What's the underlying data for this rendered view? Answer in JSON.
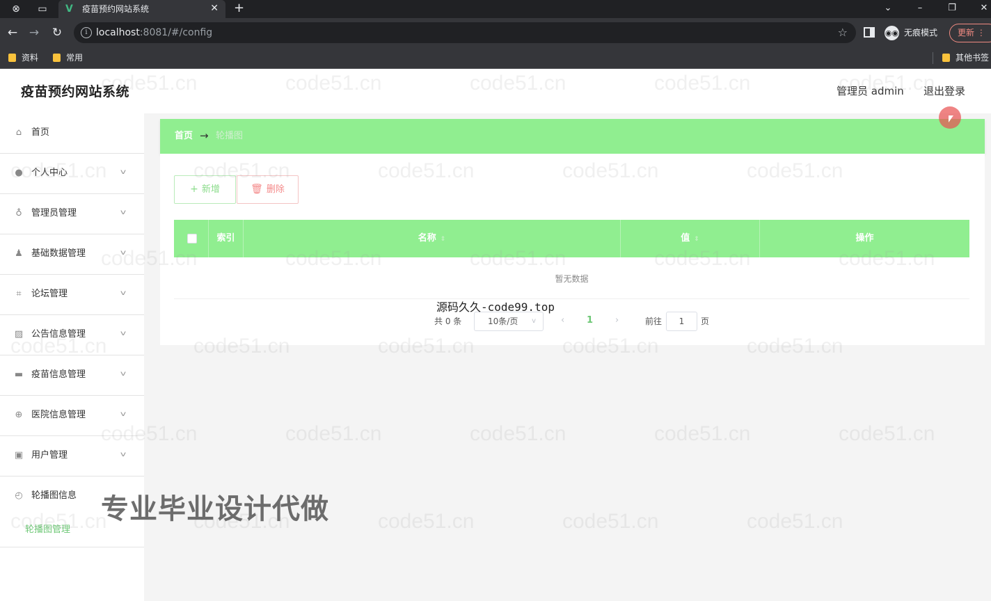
{
  "browser": {
    "tab_title": "疫苗预约网站系统",
    "tab_favicon": "V",
    "url_host": "localhost",
    "url_rest": ":8081/#/config",
    "incognito_label": "无痕模式",
    "update_label": "更新",
    "bookmarks": [
      "资料",
      "常用"
    ],
    "other_bookmarks": "其他书签"
  },
  "header": {
    "title": "疫苗预约网站系统",
    "user": "管理员 admin",
    "logout": "退出登录"
  },
  "sidebar": {
    "items": [
      {
        "label": "首页",
        "icon": "home-icon",
        "expandable": false
      },
      {
        "label": "个人中心",
        "icon": "user-icon",
        "expandable": true
      },
      {
        "label": "管理员管理",
        "icon": "microphone-icon",
        "expandable": true
      },
      {
        "label": "基础数据管理",
        "icon": "person-icon",
        "expandable": true
      },
      {
        "label": "论坛管理",
        "icon": "crop-icon",
        "expandable": true
      },
      {
        "label": "公告信息管理",
        "icon": "chart-icon",
        "expandable": true
      },
      {
        "label": "疫苗信息管理",
        "icon": "monitor-icon",
        "expandable": true
      },
      {
        "label": "医院信息管理",
        "icon": "globe-icon",
        "expandable": true
      },
      {
        "label": "用户管理",
        "icon": "clipboard-icon",
        "expandable": true
      },
      {
        "label": "轮播图信息",
        "icon": "compass-icon",
        "expandable": false
      }
    ],
    "sub_item": "轮播图管理"
  },
  "breadcrumb": {
    "home": "首页",
    "arrow": "→",
    "current": "轮播图"
  },
  "toolbar": {
    "add": "新增",
    "delete": "删除"
  },
  "table": {
    "columns": [
      "索引",
      "名称",
      "值",
      "操作"
    ],
    "empty": "暂无数据"
  },
  "pagination": {
    "total": "共 0 条",
    "page_size": "10条/页",
    "current_page": "1",
    "goto": "前往",
    "goto_value": "1",
    "page_suffix": "页"
  },
  "overlays": {
    "watermark": "code51.cn",
    "caption": "源码久久-code99.top",
    "banner": "专业毕业设计代做"
  },
  "colors": {
    "accent": "#90ee90",
    "accent_text": "#6cc774",
    "danger": "#f48a8a"
  }
}
